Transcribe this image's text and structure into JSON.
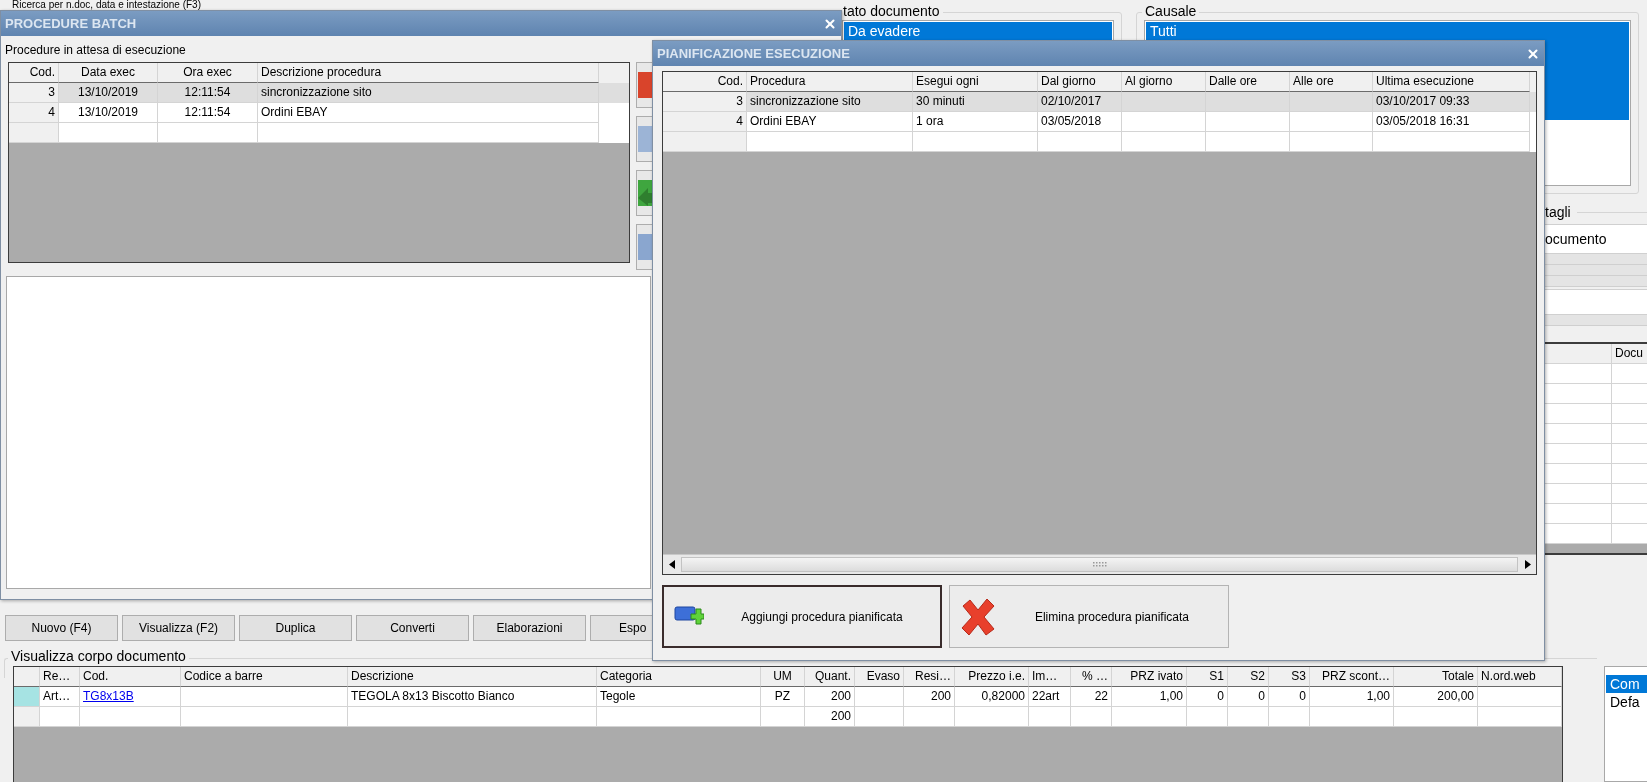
{
  "app": {
    "search_label": "Ricerca per n.doc, data e intestazione (F3)",
    "stato_documento": {
      "legend": "tato documento",
      "items": [
        {
          "label": "Da evadere",
          "selected": true
        }
      ]
    },
    "causale": {
      "legend": "Causale",
      "items": [
        {
          "label": "Tutti",
          "selected": true
        }
      ]
    },
    "dettagli": {
      "legend": "tagli",
      "field_value": "ocumento"
    },
    "side_table": {
      "columns": [
        {
          "label": "Docu"
        }
      ]
    },
    "buttons": [
      "Nuovo (F4)",
      "Visualizza (F2)",
      "Duplica",
      "Converti",
      "Elaborazioni",
      "Espo"
    ],
    "corpo": {
      "legend": "Visualizza corpo documento",
      "columns": [
        {
          "label": "Re…",
          "kind": "text"
        },
        {
          "label": "Cod.",
          "kind": "link"
        },
        {
          "label": "Codice a barre",
          "kind": "text"
        },
        {
          "label": "Descrizione",
          "kind": "text"
        },
        {
          "label": "Categoria",
          "kind": "text"
        },
        {
          "label": "UM",
          "kind": "center"
        },
        {
          "label": "Quant.",
          "kind": "number"
        },
        {
          "label": "Evaso",
          "kind": "number"
        },
        {
          "label": "Resi…",
          "kind": "number"
        },
        {
          "label": "Prezzo i.e.",
          "kind": "number"
        },
        {
          "label": "Im…",
          "kind": "text"
        },
        {
          "label": "% …",
          "kind": "number"
        },
        {
          "label": "PRZ ivato",
          "kind": "number"
        },
        {
          "label": "S1",
          "kind": "number"
        },
        {
          "label": "S2",
          "kind": "number"
        },
        {
          "label": "S3",
          "kind": "number"
        },
        {
          "label": "PRZ scont…",
          "kind": "number"
        },
        {
          "label": "Totale",
          "kind": "number"
        },
        {
          "label": "N.ord.web",
          "kind": "text"
        }
      ],
      "rows": [
        {
          "current": true,
          "cells": [
            "Art…",
            "TG8x13B",
            null,
            "TEGOLA 8x13 Biscotto Bianco",
            "Tegole",
            "PZ",
            "200",
            null,
            "200",
            "0,82000",
            "22art",
            "22",
            "1,00",
            "0",
            "0",
            "0",
            "1,00",
            "200,00",
            null
          ]
        },
        {
          "current": false,
          "cells": [
            null,
            null,
            null,
            null,
            null,
            null,
            "200",
            null,
            null,
            null,
            null,
            null,
            null,
            null,
            null,
            null,
            null,
            null,
            null
          ]
        }
      ]
    },
    "side_list": [
      {
        "label": "Com",
        "selected": true
      },
      {
        "label": "Defa",
        "selected": false
      }
    ]
  },
  "batch": {
    "title": "PROCEDURE BATCH",
    "subtitle": "Procedure in attesa di esecuzione",
    "columns": [
      {
        "label": "Cod.",
        "kind": "number"
      },
      {
        "label": "Data exec",
        "kind": "center"
      },
      {
        "label": "Ora exec",
        "kind": "center"
      },
      {
        "label": "Descrizione procedura",
        "kind": "text"
      }
    ],
    "rows": [
      {
        "selected": true,
        "cells": [
          "3",
          "13/10/2019",
          "12:11:54",
          "sincronizzazione sito"
        ]
      },
      {
        "selected": false,
        "cells": [
          "4",
          "13/10/2019",
          "12:11:54",
          "Ordini EBAY"
        ]
      }
    ]
  },
  "plan": {
    "title": "PIANIFICAZIONE ESECUZIONE",
    "columns": [
      {
        "label": "Cod.",
        "kind": "number"
      },
      {
        "label": "Procedura",
        "kind": "text"
      },
      {
        "label": "Esegui ogni",
        "kind": "text"
      },
      {
        "label": "Dal giorno",
        "kind": "text"
      },
      {
        "label": "Al giorno",
        "kind": "text"
      },
      {
        "label": "Dalle ore",
        "kind": "text"
      },
      {
        "label": "Alle ore",
        "kind": "text"
      },
      {
        "label": "Ultima esecuzione",
        "kind": "text"
      }
    ],
    "rows": [
      {
        "selected": true,
        "cells": [
          "3",
          "sincronizzazione sito",
          "30 minuti",
          "02/10/2017",
          null,
          null,
          null,
          "03/10/2017 09:33"
        ]
      },
      {
        "selected": false,
        "cells": [
          "4",
          "Ordini EBAY",
          "1 ora",
          "03/05/2018",
          null,
          null,
          null,
          "03/05/2018 16:31"
        ]
      }
    ],
    "buttons": [
      {
        "label": "Aggiungi procedura pianificata",
        "kind": "add",
        "focused": true
      },
      {
        "label": "Elimina procedura pianificata",
        "kind": "delete",
        "focused": false
      }
    ]
  }
}
